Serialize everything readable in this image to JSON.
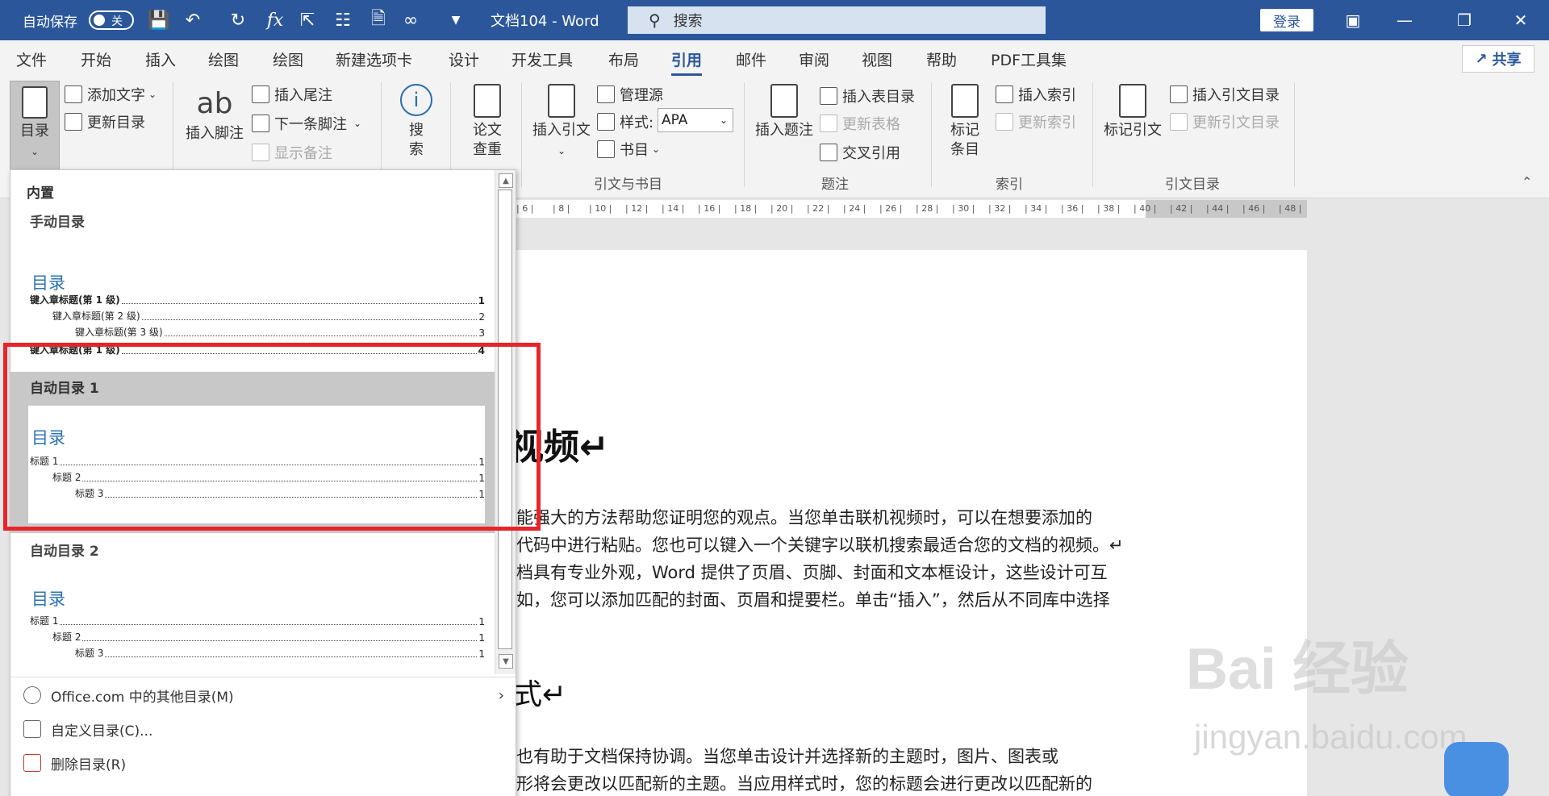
{
  "titlebar": {
    "autosave_label": "自动保存",
    "autosave_state": "关",
    "doc_title": "文档104  -  Word",
    "search_placeholder": "搜索",
    "login_label": "登录"
  },
  "menu": {
    "tabs": [
      "文件",
      "开始",
      "插入",
      "绘图",
      "绘图",
      "新建选项卡",
      "设计",
      "开发工具",
      "布局",
      "引用",
      "邮件",
      "审阅",
      "视图",
      "帮助",
      "PDF工具集"
    ],
    "active": "引用",
    "share_label": "共享"
  },
  "ribbon": {
    "toc_label": "目录",
    "add_text": "添加文字",
    "update_toc": "更新目录",
    "insert_footnote_big": "ab",
    "insert_footnote": "插入脚注",
    "insert_endnote": "插入尾注",
    "next_footnote": "下一条脚注",
    "show_notes": "显示备注",
    "search_top": "搜",
    "search_bottom": "索",
    "thesis_top": "论文",
    "thesis_bottom": "查重",
    "insert_citation": "插入引文",
    "manage_sources": "管理源",
    "style_label": "样式:",
    "style_value": "APA",
    "bibliography": "书目",
    "group_citations": "引文与书目",
    "insert_caption": "插入题注",
    "insert_table_of_figures": "插入表目录",
    "update_table": "更新表格",
    "cross_reference": "交叉引用",
    "group_captions": "题注",
    "mark_entry_top": "标记",
    "mark_entry_bottom": "条目",
    "insert_index": "插入索引",
    "update_index": "更新索引",
    "group_index": "索引",
    "mark_citation": "标记引文",
    "insert_toa": "插入引文目录",
    "update_toa": "更新引文目录",
    "group_toa": "引文目录"
  },
  "ruler": {
    "ticks": [
      "6",
      "8",
      "10",
      "12",
      "14",
      "16",
      "18",
      "20",
      "22",
      "24",
      "26",
      "28",
      "30",
      "32",
      "34",
      "36",
      "38",
      "40",
      "42",
      "44",
      "46",
      "48"
    ]
  },
  "dropdown": {
    "section_builtin": "内置",
    "manual_title": "手动目录",
    "manual_toc_title": "目录",
    "manual_lines": [
      {
        "text": "键入章标题(第 1 级)",
        "page": "1"
      },
      {
        "text": "键入章标题(第 2 级)",
        "page": "2"
      },
      {
        "text": "键入章标题(第 3 级)",
        "page": "3"
      },
      {
        "text": "键入章标题(第 1 级)",
        "page": "4"
      }
    ],
    "auto1_title": "自动目录 1",
    "auto1_toc_title": "目录",
    "auto1_lines": [
      {
        "text": "标题 1",
        "page": "1"
      },
      {
        "text": "标题 2",
        "page": "1"
      },
      {
        "text": "标题 3",
        "page": "1"
      }
    ],
    "auto2_title": "自动目录 2",
    "auto2_toc_title": "目录",
    "auto2_lines": [
      {
        "text": "标题 1",
        "page": "1"
      },
      {
        "text": "标题 2",
        "page": "1"
      },
      {
        "text": "标题 3",
        "page": "1"
      }
    ],
    "more_office": "Office.com 中的其他目录(M)",
    "custom_toc": "自定义目录(C)...",
    "remove_toc": "删除目录(R)"
  },
  "document": {
    "heading1": "视频↵",
    "para1": [
      "能强大的方法帮助您证明您的观点。当您单击联机视频时，可以在想要添加的",
      "代码中进行粘贴。您也可以键入一个关键字以联机搜索最适合您的文档的视频。↵",
      "档具有专业外观，Word 提供了页眉、页脚、封面和文本框设计，这些设计可互",
      "如，您可以添加匹配的封面、页眉和提要栏。单击“插入”，然后从不同库中选择"
    ],
    "heading2": "式↵",
    "para2": [
      "也有助于文档保持协调。当您单击设计并选择新的主题时，图片、图表或",
      "形将会更改以匹配新的主题。当应用样式时，您的标题会进行更改以匹配新的"
    ]
  },
  "watermark": {
    "brand": "Bai 经验",
    "url": "jingyan.baidu.com"
  }
}
